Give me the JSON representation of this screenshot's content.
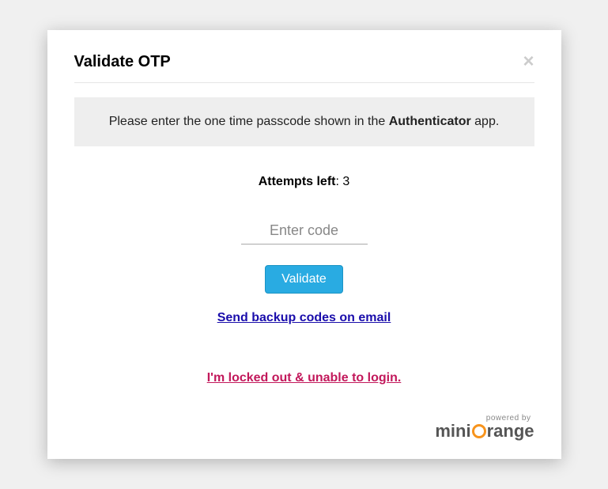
{
  "modal": {
    "title": "Validate OTP",
    "instruction_prefix": "Please enter the one time passcode shown in the ",
    "instruction_bold": "Authenticator",
    "instruction_suffix": " app.",
    "attempts_label": "Attempts left",
    "attempts_separator": ": ",
    "attempts_count": "3",
    "input_placeholder": "Enter code",
    "validate_label": "Validate",
    "backup_link": "Send backup codes on email",
    "locked_link": "I'm locked out & unable to login."
  },
  "footer": {
    "powered_by": "powered by",
    "brand_part1": "mini",
    "brand_part2": "range"
  }
}
